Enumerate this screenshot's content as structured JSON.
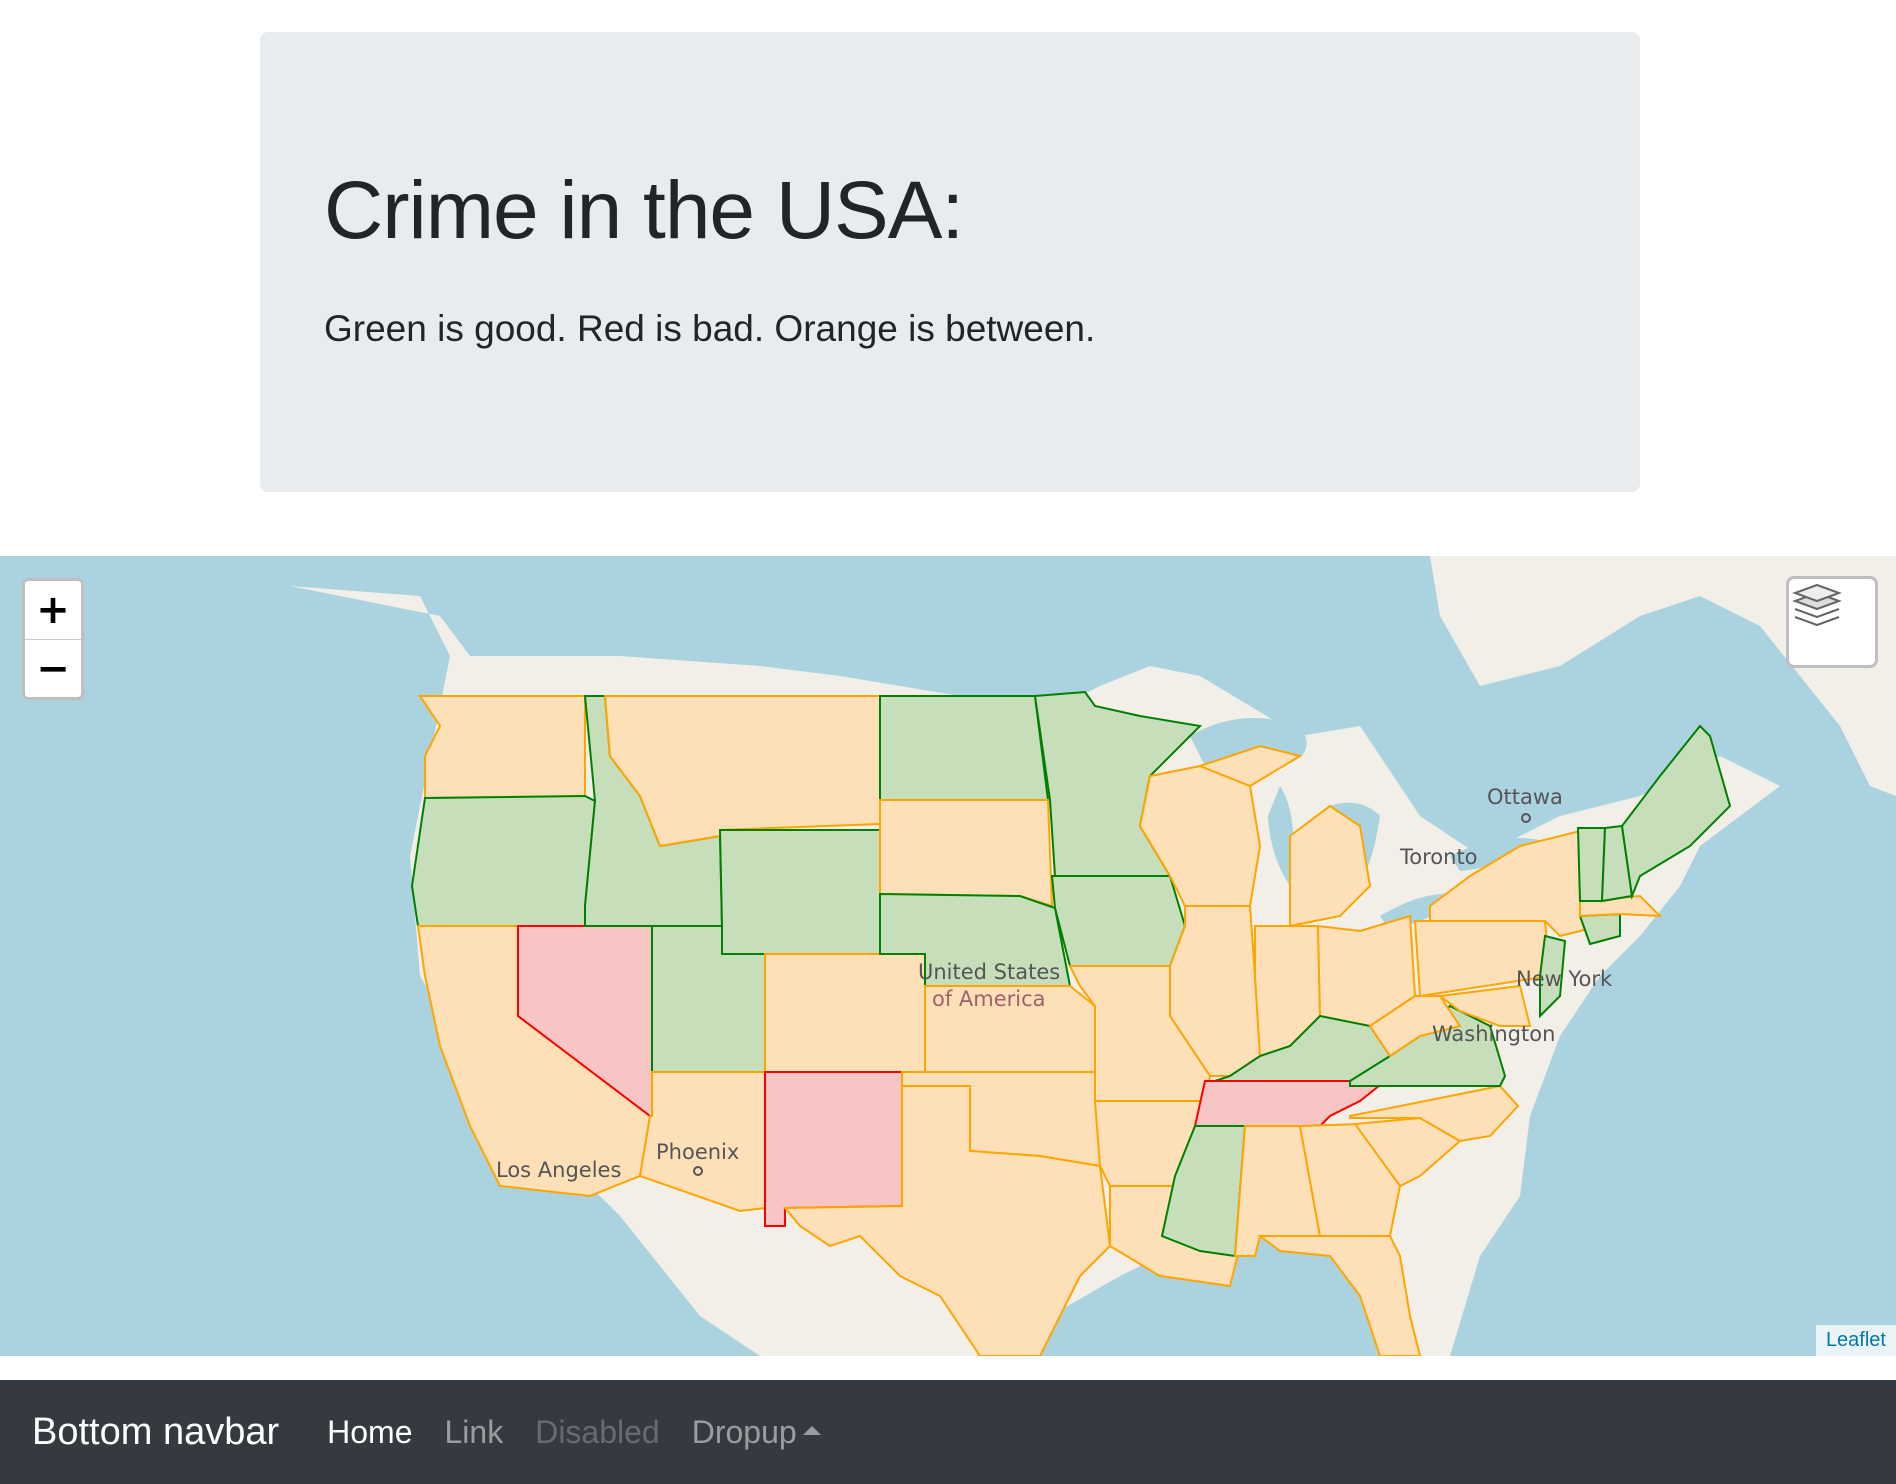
{
  "jumbotron": {
    "title": "Crime in the USA:",
    "subtitle": "Green is good. Red is bad. Orange is between."
  },
  "map": {
    "zoom_in": "+",
    "zoom_out": "−",
    "attribution": "Leaflet",
    "labels": {
      "country_line1": "United States",
      "country_line2": "of America",
      "ottawa": "Ottawa",
      "toronto": "Toronto",
      "new_york": "New York",
      "washington": "Washington",
      "los_angeles": "Los Angeles",
      "phoenix": "Phoenix"
    },
    "colors": {
      "good": "#008000",
      "bad": "#ff0000",
      "between": "#ffa500",
      "water": "#aad3df",
      "land": "#f2efe9"
    },
    "ratings": {
      "green": [
        "Oregon",
        "Idaho",
        "Wyoming",
        "Utah",
        "North Dakota",
        "Minnesota",
        "Nebraska",
        "Iowa",
        "Kentucky",
        "Virginia",
        "Mississippi",
        "Vermont",
        "New Hampshire",
        "Maine",
        "Connecticut",
        "New Jersey"
      ],
      "red": [
        "Nevada",
        "New Mexico",
        "Tennessee"
      ]
    }
  },
  "navbar": {
    "brand": "Bottom navbar",
    "items": [
      {
        "label": "Home",
        "state": "active"
      },
      {
        "label": "Link",
        "state": "link"
      },
      {
        "label": "Disabled",
        "state": "disabled"
      },
      {
        "label": "Dropup",
        "state": "link"
      }
    ]
  }
}
